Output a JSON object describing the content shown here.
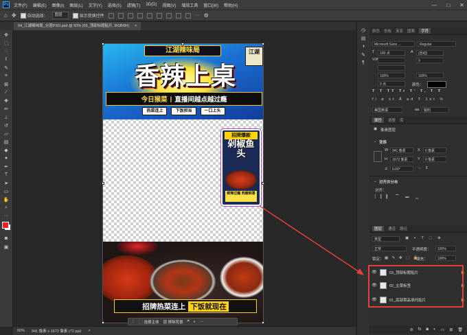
{
  "menubar": {
    "app_logo": "Ps",
    "items": [
      "文件(F)",
      "编辑(E)",
      "图像(I)",
      "图层(L)",
      "文字(Y)",
      "选择(S)",
      "滤镜(T)",
      "3D(D)",
      "视图(V)",
      "增效工具",
      "窗口(W)",
      "帮助(H)"
    ],
    "window_controls": [
      "—",
      "□",
      "✕"
    ]
  },
  "optionsbar": {
    "auto_select_label": "自动选择：",
    "auto_select_value": "图层",
    "show_transform_label": "显示变换控件"
  },
  "document": {
    "tab_title": "04_江湖辣味局_分层PSD.psd @ 50% (03_顶部标题贴片, RGB/8#)",
    "close_glyph": "×"
  },
  "artwork": {
    "brand_title": "江湖辣味局",
    "headline": "香辣上桌",
    "stripe_left": "今日猴菜",
    "stripe_divider": "|",
    "stripe_right": "直播间越点越过瘾",
    "tags": [
      "热菜连上",
      "下饭担当",
      "一口上头"
    ],
    "seal_text": "江湖",
    "card_top": "招牌爆款",
    "card_name": "剁椒鱼头",
    "card_bottom": "鲜辣过瘾 肉嫩鲜香",
    "bottom_left": "招牌热菜连上",
    "bottom_right": "下饭就现在"
  },
  "context_bar": {
    "select_subject": "选择主体",
    "remove_bg": "移除背景"
  },
  "status": {
    "zoom": "50%",
    "dimensions": "941 像素 x 1672 像素 (72 ppi)",
    "arrow": ">"
  },
  "panels": {
    "top_tabs": [
      "颜色",
      "色板",
      "渐变",
      "图案",
      "字符"
    ],
    "top_active": "字符",
    "font_family": "Microsoft Sans ...",
    "font_style": "Regular",
    "font_size": "100 点",
    "leading": "(自动)",
    "va_label": "V/A",
    "tracking": "0",
    "scale_v": "100%",
    "scale_h": "100%",
    "baseline": "0 点",
    "color_label": "颜色：",
    "language": "美国英语",
    "aa_label": "aa",
    "aa_value": "锐利",
    "props_tabs": [
      "属性",
      "调整",
      "库"
    ],
    "props_active": "属性",
    "pixel_layer": "像素图层",
    "transform_title": "变换",
    "w_label": "W",
    "w_value": "941 像素",
    "x_label": "X",
    "x_value": "0 像素",
    "h_label": "H",
    "h_value": "1672 像素",
    "y_label": "Y",
    "y_value": "0 像素",
    "angle": "0.00°",
    "align_title": "对齐并分布",
    "align_sub": "对齐：",
    "layers_tabs": [
      "图层",
      "通道",
      "路径"
    ],
    "layers_active": "图层",
    "kind": "类型",
    "blend_mode": "正常",
    "opacity_label": "不透明度：",
    "opacity_value": "100%",
    "lock_label": "锁定：",
    "fill_label": "填充：",
    "fill_value": "100%",
    "layers": [
      {
        "name": "03_顶部标题贴片"
      },
      {
        "name": "02_主菜标签"
      },
      {
        "name": "01_底部菜品承托贴片"
      }
    ]
  },
  "colors": {
    "accent": "#31a8ff",
    "highlight": "#e8403a",
    "foreground": "#e8202a",
    "background": "#ffffff"
  }
}
